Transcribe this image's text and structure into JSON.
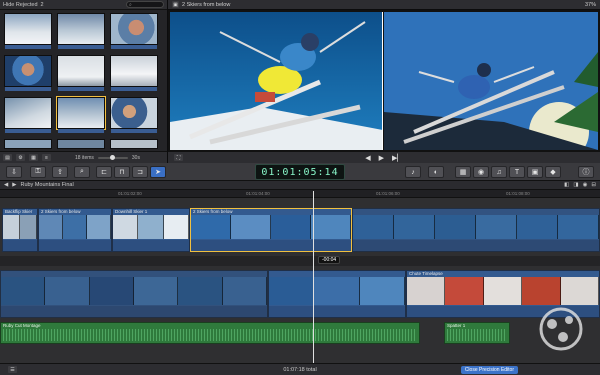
{
  "browser": {
    "filter_label": "Hide Rejected",
    "filter_count": "2",
    "items_count": "18 items",
    "duration": "30s"
  },
  "viewer": {
    "title": "2 Skiers from below",
    "zoom": "37%"
  },
  "toolbar": {
    "timecode": "01:01:05:14"
  },
  "timeline": {
    "project": "Ruby Mountains Final",
    "ruler": [
      "01:01:02:00",
      "01:01:04:00",
      "01:01:06:00",
      "01:01:08:00"
    ],
    "clips_primary": [
      {
        "label": "Backflip Skier"
      },
      {
        "label": "2 Skiers from below"
      },
      {
        "label": "Downhill Skier 1"
      },
      {
        "label": "2 Skiers from below"
      }
    ],
    "clip_secondary": "Chute Timelapse",
    "audio_1": "Ruby Cut Montage",
    "audio_2": "Spatter 1",
    "playhead_label": "-00:04"
  },
  "status": {
    "duration": "01:07:18 total",
    "close_button": "Close Precision Editor"
  },
  "colors": {
    "accent": "#3a6fc4",
    "clip_blue": "#335a8f",
    "audio_green": "#2f7a3c",
    "timecode": "#88f5c8"
  }
}
